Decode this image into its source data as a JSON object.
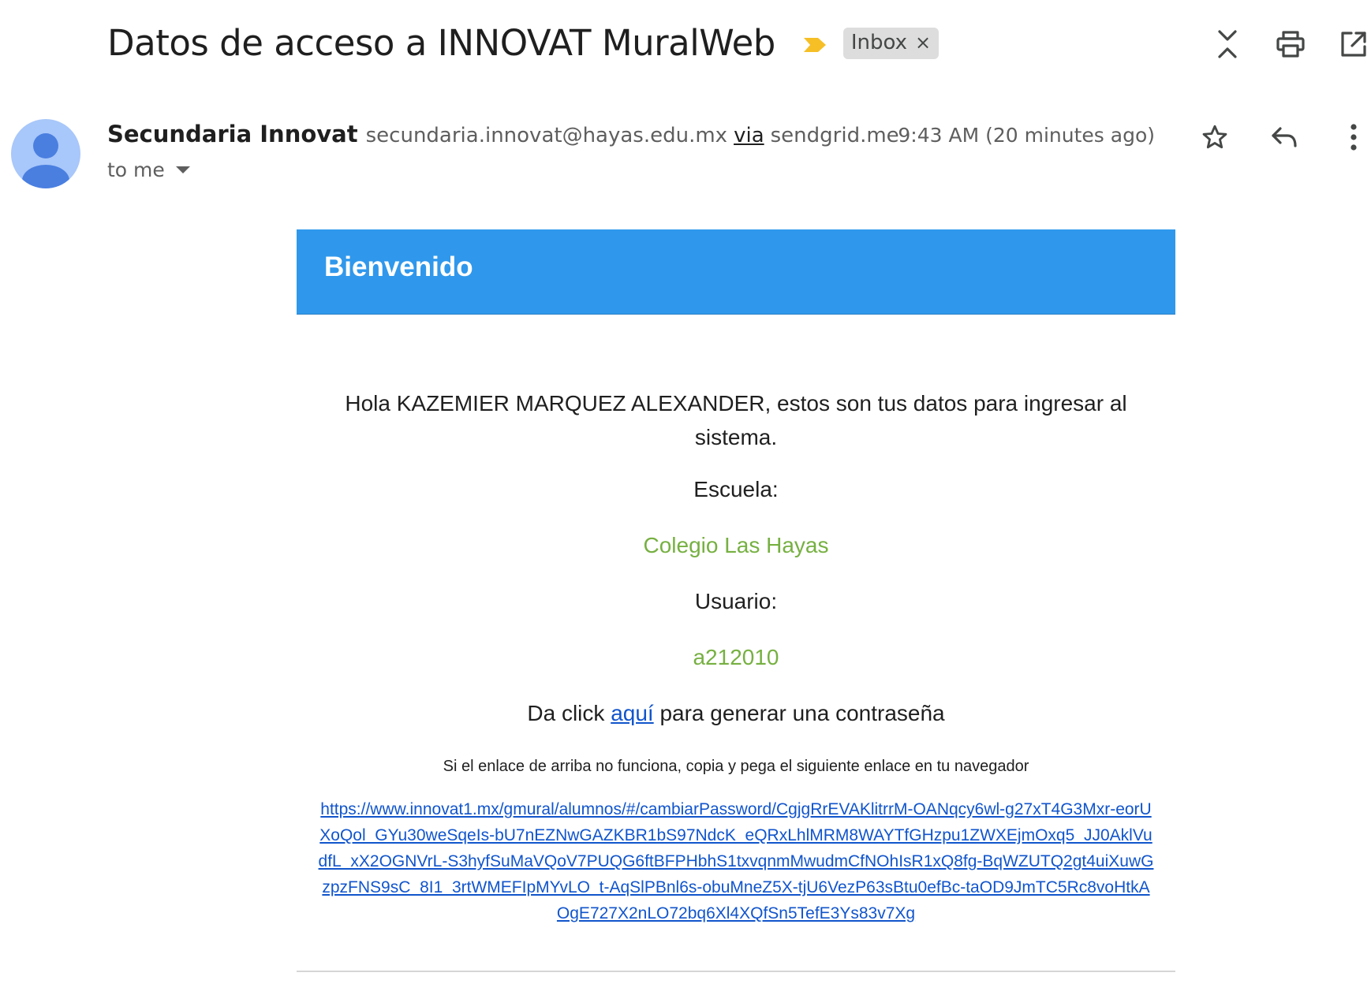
{
  "subject": {
    "title": "Datos de acceso a INNOVAT MuralWeb",
    "label_chip": "Inbox",
    "label_remove": "×"
  },
  "top_actions": [
    "expand-collapse-icon",
    "print-icon",
    "open-new-window-icon"
  ],
  "message": {
    "sender_name": "Secundaria Innovat",
    "sender_email": "secundaria.innovat@hayas.edu.mx",
    "via_label": "via",
    "via_domain": "sendgrid.me",
    "recipient": "to me",
    "timestamp": "9:43 AM (20 minutes ago)",
    "actions": [
      "star-icon",
      "reply-icon",
      "more-vert-icon"
    ]
  },
  "email_body": {
    "banner_title": "Bienvenido",
    "greeting": "Hola KAZEMIER MARQUEZ ALEXANDER, estos son tus datos para ingresar al sistema.",
    "school_label": "Escuela:",
    "school_value": "Colegio Las Hayas",
    "user_label": "Usuario:",
    "user_value": "a212010",
    "click_prefix": "Da click ",
    "click_link": "aquí",
    "click_suffix": " para generar una contraseña",
    "fallback_note": "Si el enlace de arriba no funciona, copia y pega el siguiente enlace en tu navegador",
    "fallback_url": "https://www.innovat1.mx/gmural/alumnos/#/cambiarPassword/CgjgRrEVAKlitrrM-OANqcy6wl-g27xT4G3Mxr-eorUXoQol_GYu30weSqeIs-bU7nEZNwGAZKBR1bS97NdcK_eQRxLhlMRM8WAYTfGHzpu1ZWXEjmOxq5_JJ0AklVudfL_xX2OGNVrL-S3hyfSuMaVQoV7PUQG6ftBFPHbhS1txvqnmMwudmCfNOhIsR1xQ8fg-BqWZUTQ2gt4uiXuwGzpzFNS9sC_8I1_3rtWMEFIpMYvLO_t-AqSlPBnl6s-obuMneZ5X-tjU6VezP63sBtu0efBc-taOD9JmTC5Rc8voHtkAOgE727X2nLO72bq6Xl4XQfSn5TefE3Ys83v7Xg"
  },
  "colors": {
    "banner": "#2f98ec",
    "highlight_green": "#76b041",
    "link": "#1155cc",
    "importance_marker": "#f6bf26",
    "avatar_bg": "#a8c7fa",
    "avatar_fg": "#4a7fe0"
  }
}
